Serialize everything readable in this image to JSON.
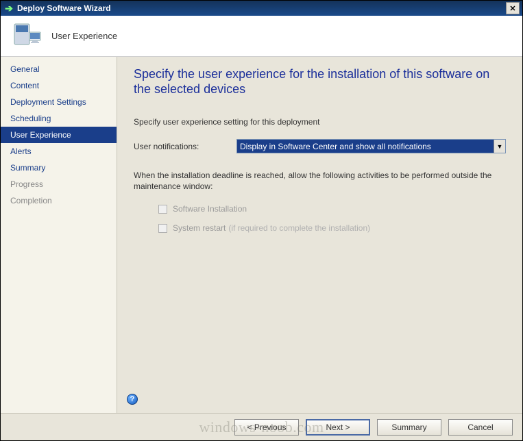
{
  "window": {
    "title": "Deploy Software Wizard"
  },
  "header": {
    "page_name": "User Experience"
  },
  "sidebar": {
    "items": [
      {
        "label": "General",
        "active": false,
        "muted": false
      },
      {
        "label": "Content",
        "active": false,
        "muted": false
      },
      {
        "label": "Deployment Settings",
        "active": false,
        "muted": false
      },
      {
        "label": "Scheduling",
        "active": false,
        "muted": false
      },
      {
        "label": "User Experience",
        "active": true,
        "muted": false
      },
      {
        "label": "Alerts",
        "active": false,
        "muted": false
      },
      {
        "label": "Summary",
        "active": false,
        "muted": false
      },
      {
        "label": "Progress",
        "active": false,
        "muted": true
      },
      {
        "label": "Completion",
        "active": false,
        "muted": true
      }
    ]
  },
  "main": {
    "heading": "Specify the user experience for the installation of this software on the selected devices",
    "instruction": "Specify user experience setting for this deployment",
    "notifications_label": "User notifications:",
    "notifications_value": "Display in Software Center and show all notifications",
    "deadline_text": "When the installation deadline is reached, allow the following activities to be performed outside the maintenance window:",
    "checkbox1_label": "Software Installation",
    "checkbox2_label": "System restart",
    "checkbox2_sub": "(if required to complete the installation)"
  },
  "footer": {
    "previous": "< Previous",
    "next": "Next >",
    "summary": "Summary",
    "cancel": "Cancel"
  },
  "watermark": "windows-noob.com"
}
